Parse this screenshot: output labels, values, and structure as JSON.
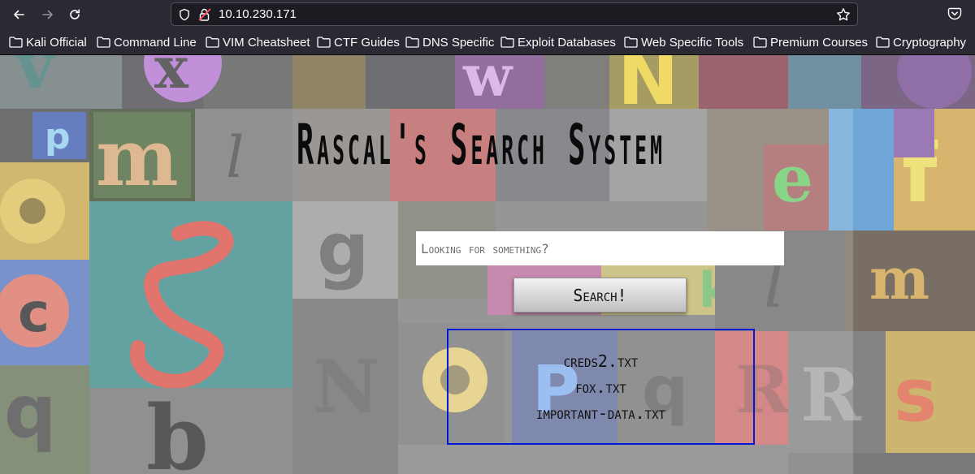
{
  "browser": {
    "url": "10.10.230.171",
    "bookmarks": [
      "Kali Official",
      "Command Line",
      "VIM Cheatsheet",
      "CTF Guides",
      "DNS Specific",
      "Exploit Databases",
      "Web Specific Tools",
      "Premium Courses",
      "Cryptography"
    ]
  },
  "page": {
    "title": "Rascal's Search System",
    "search_placeholder": "Looking for something?",
    "search_button": "Search!",
    "results": [
      "creds2.txt",
      "fox.txt",
      "important-data.txt"
    ],
    "colors": {
      "results_border": "#0018d8",
      "title_text": "#0b0b0b"
    }
  }
}
